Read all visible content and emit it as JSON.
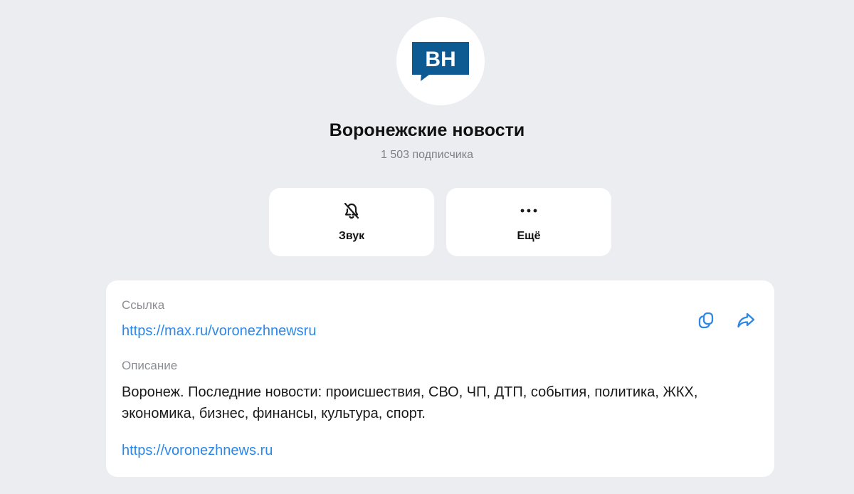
{
  "channel": {
    "logo_text": "ВН",
    "title": "Воронежские новости",
    "subscribers": "1 503 подписчика"
  },
  "actions": {
    "sound_label": "Звук",
    "sound_icon": "bell-off-icon",
    "more_label": "Ещё",
    "more_icon": "more-dots-icon"
  },
  "info": {
    "link_label": "Ссылка",
    "link_value": "https://max.ru/voronezhnewsru",
    "description_label": "Описание",
    "description_text": "Воронеж. Последние новости: происшествия, СВО, ЧП, ДТП, события, политика, ЖКХ, экономика, бизнес, финансы, культура, спорт.",
    "description_link": "https://voronezhnews.ru",
    "copy_icon": "copy-icon",
    "share_icon": "share-icon"
  },
  "colors": {
    "background": "#ebedf0",
    "card": "#ffffff",
    "accent_link": "#2d87e6",
    "logo_blue": "#0d5a93",
    "muted_text": "#8a8e94"
  }
}
